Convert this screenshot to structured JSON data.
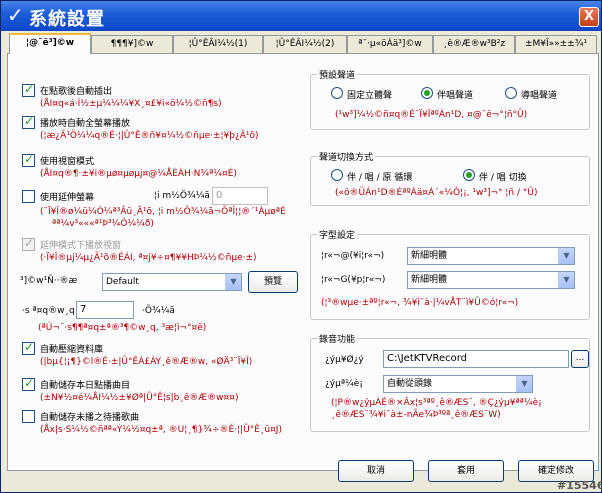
{
  "window": {
    "title": "系統設置",
    "close": "X"
  },
  "tabs": [
    "¦@¯ë³]©w",
    "¶¶¶¥]©w",
    "¦Û°ÊÂI¼½(1)",
    "¦Û°ÊÂI¼½(2)",
    "ª¯·µ«öÁä³]©w",
    "¸ê®Æ®w³B²z",
    "±M¥Î»»±±¾¹"
  ],
  "left": {
    "items": [
      {
        "label": "在點歌後自動插出",
        "desc": [
          "(ÅI¤q«á·Í½±µ¼¼¼¥X¸¤£¥i«ö¼½©ñ¶s)"
        ],
        "checked": true
      },
      {
        "label": "播放時自動全螢幕播放",
        "desc": [
          "(¦æ¿Ã¹Ö¼¼q®É·¦|Û°Ê®ñ¥¤¼½©ñµe·±¦¥þ¿Ã¹õ)"
        ],
        "checked": true
      },
      {
        "label": "使用視窗模式",
        "desc": [
          "(ÅI¤q®¶·±¥i®µø¤µøµj¤@¼ÅÈÀH·N¾ª¼¤É)"
        ],
        "checked": true
      },
      {
        "label": "使用延伸螢幕",
        "desc": [
          "(¨Ï¥Î®ø¼ü¼Ò¼ª³Ãü¸Ã¹õ, ¦i m½Ö¾¼ã¬ÕªÎ¦¦®´¹ÁµøªÉ",
          "ªª¼v³«««ª¹Þ³¼Ö¼¼ð)"
        ],
        "checked": false,
        "disabled_extra": true
      },
      {
        "label": "延伸模式下播放視窗",
        "desc": [
          "(·Ï¥Î®µj¼µ¿Ã¹õ®ÉÁI, ª¤j¥÷¤¶¥¥HÞ¼½©ñµe·±)"
        ],
        "checked": true,
        "disabled": true
      }
    ],
    "ext_position_label": "¦i m½Ö¾¼ã",
    "ext_position_value": "0",
    "preset_label": "³]©w¹Ñ··®æ",
    "preset_value": "Default",
    "preset_btn": "預覽",
    "volume_label": "·s ª¤q®w¸q",
    "volume_value": "7",
    "volume_unit": "·Ö¾¼ã",
    "volume_desc": "(ªÚ¬¨·s¶¶ª¤q±ª®³¶©w¸q, ³æ¦ì¬°¤ë)",
    "items2": [
      {
        "label": "自動壓縮資料庫",
        "desc": [
          "(|bµ{¦¡¶}©l®É·±|Û°ÊÀ£ÁY¸ê®Æ®w, «ØÄ³¨Ï¥Î)"
        ],
        "checked": true
      },
      {
        "label": "自動儲存本日點播曲目",
        "desc": [
          "(±N¥½¤é¼ÅI¼½±¥Øª|Û°Ê¦s|b¸ê®Æ®w¤¤)"
        ],
        "checked": true
      },
      {
        "label": "自動儲存未播之待播歌曲",
        "desc": [
          "(Åx|s·S¼½©ñªª«Ý¼½¤q±ª, ®U¦¸¶}¾÷®É·¦|Û°Ê¸ü¤J)"
        ],
        "checked": false
      }
    ]
  },
  "right": {
    "fs1": {
      "legend": "預設聲道",
      "options": [
        "固定立體聲",
        "伴唱聲道",
        "導唱聲道"
      ],
      "selected": 1,
      "desc": "(¹w³]¼½©ñ¤q®É¨Ï¥ÎªºÁn¹D, ¤@¯ë¬°¦ñ°Û)"
    },
    "fs2": {
      "legend": "聲道切換方式",
      "options": [
        "伴 / 唱 / 原 循環",
        "伴 / 唱  切換"
      ],
      "selected": 1,
      "desc": "(«ö®ÜÁn¹D®ÉªºÁä¤Á´«¼Ò¦¡, ¹w³]¬° ¦ñ / °Û)"
    },
    "fs3": {
      "legend": "字型設定",
      "row1_label": "¦r«¬@(¥i¦r«¬)",
      "row1_value": "新細明體",
      "row2_label": "¦r«¬G(¥p¦r«¬)",
      "row2_value": "新細明體",
      "desc": "(¦³®wµe·±ªº¦r«¬, ¾¥i¯à·|¼vÅT¨ì¥Û©ó¦r«¬)"
    },
    "fs4": {
      "legend": "錄音功能",
      "path_label": "¿ý­µ¥Ø¿ý",
      "path_value": "C:\\JetKTVRecord",
      "browse": "...",
      "mode_label": "¿ý­µª¼è¡",
      "mode_value": "自動從頭錄",
      "desc": [
        "(¦P®w¿ý­µÀÉ®×Âx¦s³ªº¸ê®ÆS¨, ®Ç¿ý­µ¥ªª¼è¡",
        "¸ê®ÆS¨¾¥i¯à±-nÃe¾Þ³ºª¸ê®ÆS¨W)"
      ]
    }
  },
  "buttons": {
    "cancel": "取消",
    "apply": "套用",
    "ok": "確定修改"
  },
  "watermark": "#15546"
}
